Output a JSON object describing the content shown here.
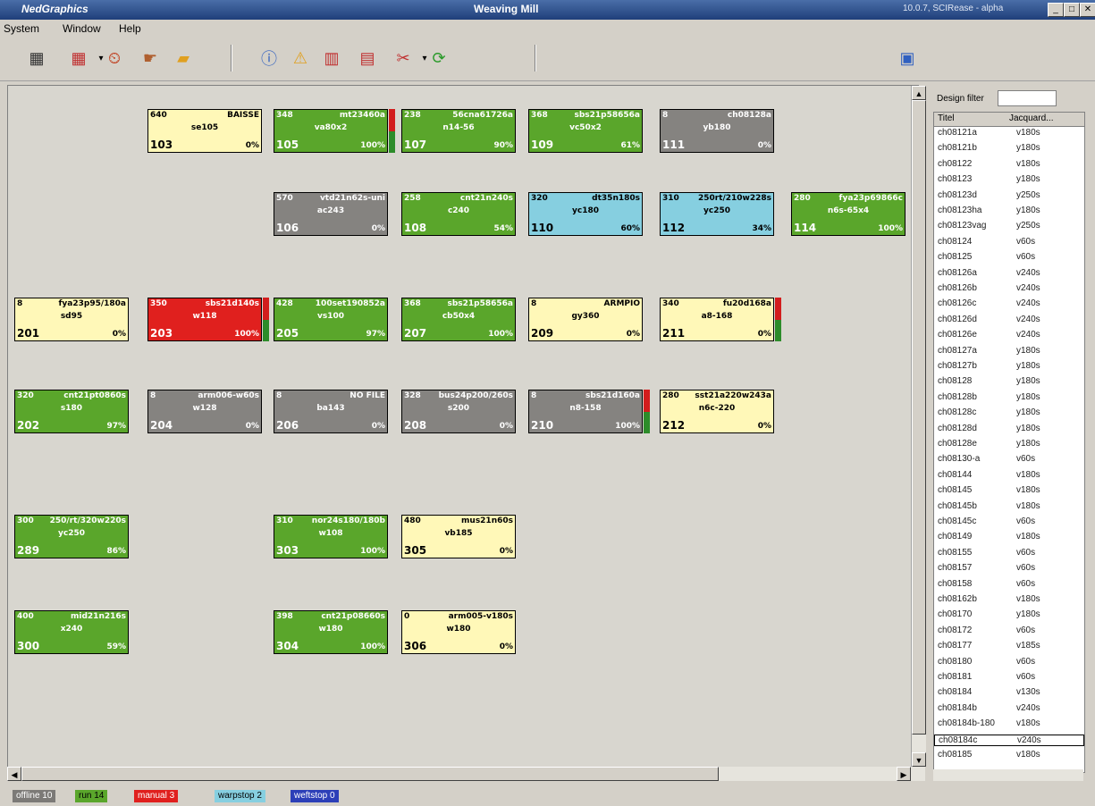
{
  "window": {
    "app_name": "NedGraphics",
    "title": "Weaving Mill",
    "version": "10.0.7, SCIRease - alpha"
  },
  "menu": [
    "System",
    "Window",
    "Help"
  ],
  "design_filter": {
    "label": "Design filter",
    "value": ""
  },
  "table": {
    "columns": [
      "Titel",
      "Jacquard..."
    ],
    "rows": [
      [
        "ch08121a",
        "v180s"
      ],
      [
        "ch08121b",
        "y180s"
      ],
      [
        "ch08122",
        "v180s"
      ],
      [
        "ch08123",
        "y180s"
      ],
      [
        "ch08123d",
        "y250s"
      ],
      [
        "ch08123ha",
        "y180s"
      ],
      [
        "ch08123vag",
        "y250s"
      ],
      [
        "ch08124",
        "v60s"
      ],
      [
        "ch08125",
        "v60s"
      ],
      [
        "ch08126a",
        "v240s"
      ],
      [
        "ch08126b",
        "v240s"
      ],
      [
        "ch08126c",
        "v240s"
      ],
      [
        "ch08126d",
        "v240s"
      ],
      [
        "ch08126e",
        "v240s"
      ],
      [
        "ch08127a",
        "y180s"
      ],
      [
        "ch08127b",
        "y180s"
      ],
      [
        "ch08128",
        "y180s"
      ],
      [
        "ch08128b",
        "y180s"
      ],
      [
        "ch08128c",
        "y180s"
      ],
      [
        "ch08128d",
        "y180s"
      ],
      [
        "ch08128e",
        "y180s"
      ],
      [
        "ch08130-a",
        "v60s"
      ],
      [
        "ch08144",
        "v180s"
      ],
      [
        "ch08145",
        "v180s"
      ],
      [
        "ch08145b",
        "v180s"
      ],
      [
        "ch08145c",
        "v60s"
      ],
      [
        "ch08149",
        "v180s"
      ],
      [
        "ch08155",
        "v60s"
      ],
      [
        "ch08157",
        "v60s"
      ],
      [
        "ch08158",
        "v60s"
      ],
      [
        "ch08162b",
        "v180s"
      ],
      [
        "ch08170",
        "y180s"
      ],
      [
        "ch08172",
        "v60s"
      ],
      [
        "ch08177",
        "v185s"
      ],
      [
        "ch08180",
        "v60s"
      ],
      [
        "ch08181",
        "v60s"
      ],
      [
        "ch08184",
        "v130s"
      ],
      [
        "ch08184b",
        "v240s"
      ],
      [
        "ch08184b-180",
        "v180s"
      ],
      [
        "ch08184c",
        "v240s"
      ],
      [
        "ch08185",
        "v180s"
      ]
    ]
  },
  "statusbar": [
    "offline 10",
    "run 14",
    "manual 3",
    "warpstop 2",
    "weftstop 0"
  ],
  "looms": [
    {
      "id": "103",
      "tl": "640",
      "tr": "BAISSE",
      "c": "se105",
      "pct": "0%",
      "status": "idle"
    },
    {
      "id": "105",
      "tl": "348",
      "tr": "mt23460a",
      "c": "va80x2",
      "pct": "100%",
      "status": "run",
      "bar": true
    },
    {
      "id": "107",
      "tl": "238",
      "tr": "56cna61726a",
      "c": "n14-56",
      "pct": "90%",
      "status": "run"
    },
    {
      "id": "109",
      "tl": "368",
      "tr": "sbs21p58656a",
      "c": "vc50x2",
      "pct": "61%",
      "status": "run"
    },
    {
      "id": "111",
      "tl": "8",
      "tr": "ch08128a",
      "c": "yb180",
      "pct": "0%",
      "status": "stop"
    },
    {
      "id": "106",
      "tl": "570",
      "tr": "vtd21n62s-uni",
      "c": "ac243",
      "pct": "0%",
      "status": "stop"
    },
    {
      "id": "108",
      "tl": "258",
      "tr": "cnt21n240s",
      "c": "c240",
      "pct": "54%",
      "status": "run"
    },
    {
      "id": "110",
      "tl": "320",
      "tr": "dt35n180s",
      "c": "yc180",
      "pct": "60%",
      "status": "warp"
    },
    {
      "id": "112",
      "tl": "310",
      "tr": "250rt/210w228s",
      "c": "yc250",
      "pct": "34%",
      "status": "warp"
    },
    {
      "id": "114",
      "tl": "280",
      "tr": "fya23p69866c",
      "c": "n6s-65x4",
      "pct": "100%",
      "status": "run"
    },
    {
      "id": "201",
      "tl": "8",
      "tr": "fya23p95/180a",
      "c": "sd95",
      "pct": "0%",
      "status": "idle"
    },
    {
      "id": "203",
      "tl": "350",
      "tr": "sbs21d140s",
      "c": "w118",
      "pct": "100%",
      "status": "manual",
      "bar": true
    },
    {
      "id": "205",
      "tl": "428",
      "tr": "100set190852a",
      "c": "vs100",
      "pct": "97%",
      "status": "run"
    },
    {
      "id": "207",
      "tl": "368",
      "tr": "sbs21p58656a",
      "c": "cb50x4",
      "pct": "100%",
      "status": "run"
    },
    {
      "id": "209",
      "tl": "8",
      "tr": "ARMPIO",
      "c": "gy360",
      "pct": "0%",
      "status": "idle"
    },
    {
      "id": "211",
      "tl": "340",
      "tr": "fu20d168a",
      "c": "a8-168",
      "pct": "0%",
      "status": "idle",
      "bar": true
    },
    {
      "id": "202",
      "tl": "320",
      "tr": "cnt21pt0860s",
      "c": "s180",
      "pct": "97%",
      "status": "run"
    },
    {
      "id": "204",
      "tl": "8",
      "tr": "arm006-w60s",
      "c": "w128",
      "pct": "0%",
      "status": "stop"
    },
    {
      "id": "206",
      "tl": "8",
      "tr": "NO FILE",
      "c": "ba143",
      "pct": "0%",
      "status": "stop"
    },
    {
      "id": "208",
      "tl": "328",
      "tr": "bus24p200/260s",
      "c": "s200",
      "pct": "0%",
      "status": "stop"
    },
    {
      "id": "210",
      "tl": "8",
      "tr": "sbs21d160a",
      "c": "n8-158",
      "pct": "100%",
      "status": "stop",
      "bar": true
    },
    {
      "id": "212",
      "tl": "280",
      "tr": "sst21a220w243a",
      "c": "n6c-220",
      "pct": "0%",
      "status": "idle"
    },
    {
      "id": "289",
      "tl": "300",
      "tr": "250/rt/320w220s",
      "c": "yc250",
      "pct": "86%",
      "status": "run"
    },
    {
      "id": "303",
      "tl": "310",
      "tr": "nor24s180/180b",
      "c": "w108",
      "pct": "100%",
      "status": "run"
    },
    {
      "id": "305",
      "tl": "480",
      "tr": "mus21n60s",
      "c": "vb185",
      "pct": "0%",
      "status": "idle"
    },
    {
      "id": "300",
      "tl": "400",
      "tr": "mid21n216s",
      "c": "x240",
      "pct": "59%",
      "status": "run"
    },
    {
      "id": "304",
      "tl": "398",
      "tr": "cnt21p08660s",
      "c": "w180",
      "pct": "100%",
      "status": "run"
    },
    {
      "id": "306",
      "tl": "0",
      "tr": "arm005-v180s",
      "c": "w180",
      "pct": "0%",
      "status": "idle"
    }
  ]
}
